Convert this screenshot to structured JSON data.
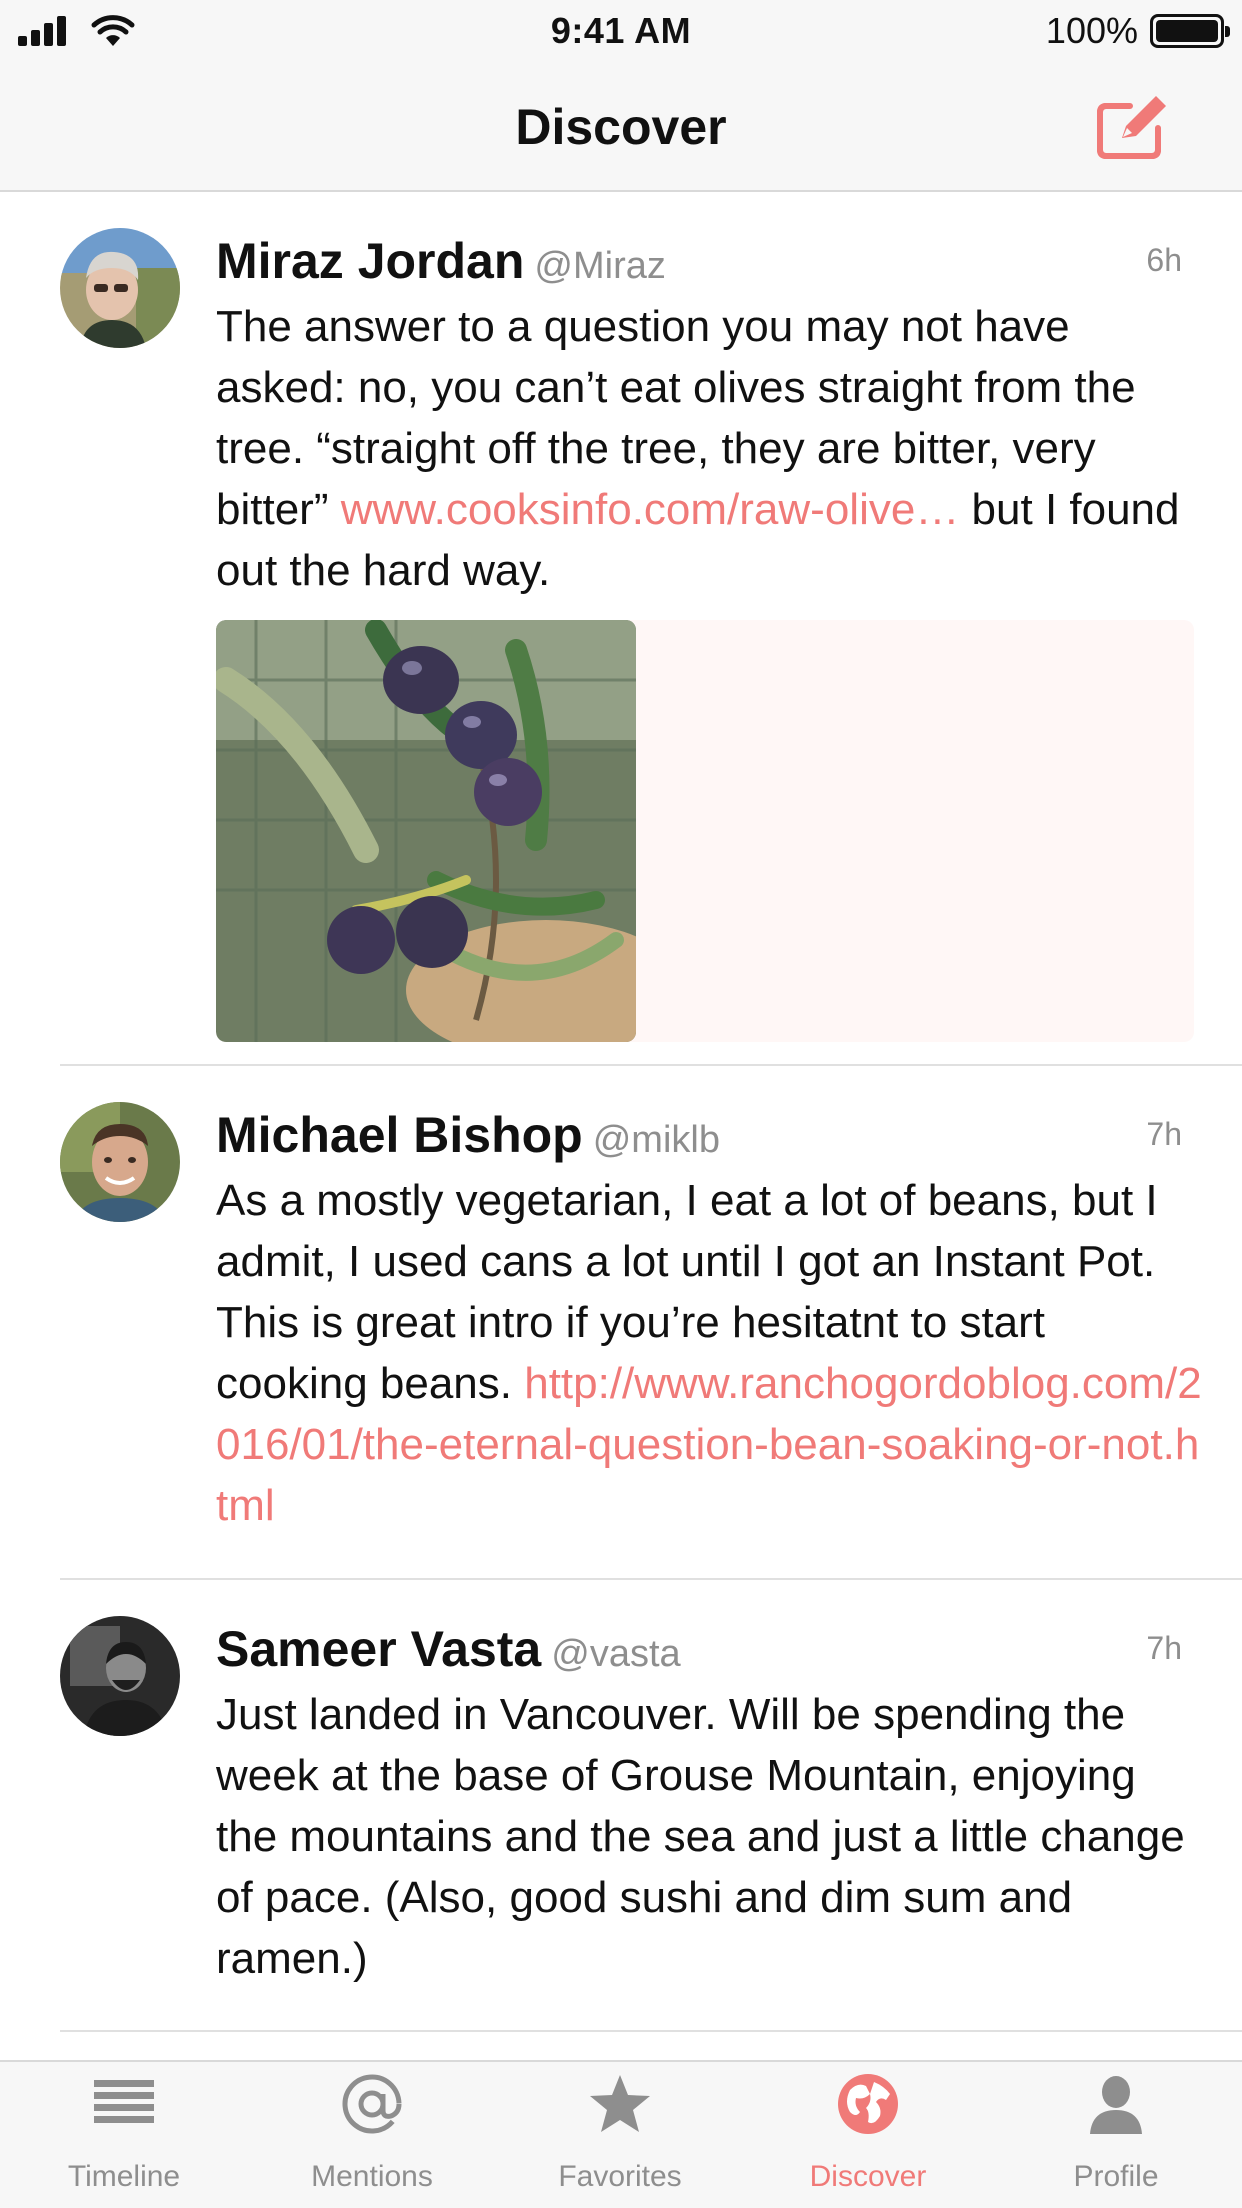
{
  "status_bar": {
    "time": "9:41 AM",
    "battery": "100%"
  },
  "nav": {
    "title": "Discover",
    "compose_icon": "compose-icon"
  },
  "colors": {
    "accent": "#f07a78",
    "tab_inactive": "#8e8e8e"
  },
  "posts": [
    {
      "name": "Miraz Jordan",
      "handle": "@Miraz",
      "time": "6h",
      "text_before": "The answer to a question you may not have asked: no, you can’t eat olives straight from the tree. “straight off the tree, they are bitter, very bitter” ",
      "link": "www.cooksinfo.com/raw-olive…",
      "text_after": " but I found out the hard way.",
      "has_photo": true
    },
    {
      "name": "Michael Bishop",
      "handle": "@miklb",
      "time": "7h",
      "text_before": "As a mostly vegetarian, I eat a lot of beans, but I admit, I used cans a lot until I got an Instant Pot. This is great intro if you’re hesitatnt to start cooking beans. ",
      "link": "http://www.ranchogordoblog.com/2016/01/the-eternal-question-bean-soaking-or-not.html",
      "text_after": ""
    },
    {
      "name": "Sameer Vasta",
      "handle": "@vasta",
      "time": "7h",
      "text_before": "Just landed in Vancouver. Will be spending the week at the base of Grouse Mountain, enjoying the mountains and the sea and just a little change of pace. (Also, good sushi and dim sum and ramen.)",
      "link": "",
      "text_after": ""
    }
  ],
  "tabs": [
    {
      "label": "Timeline",
      "icon": "timeline-icon",
      "active": false
    },
    {
      "label": "Mentions",
      "icon": "at-icon",
      "active": false
    },
    {
      "label": "Favorites",
      "icon": "star-icon",
      "active": false
    },
    {
      "label": "Discover",
      "icon": "globe-icon",
      "active": true
    },
    {
      "label": "Profile",
      "icon": "person-icon",
      "active": false
    }
  ]
}
